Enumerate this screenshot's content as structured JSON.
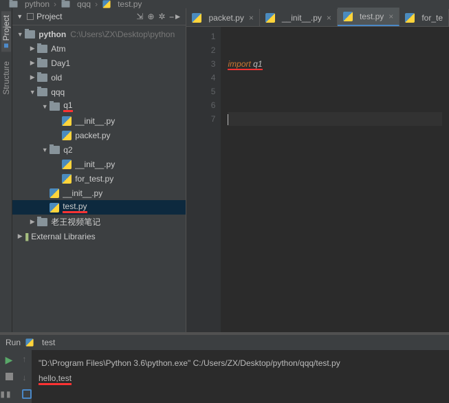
{
  "breadcrumbs": {
    "root": "python",
    "mid": "qqq",
    "file": "test.py"
  },
  "sideTabs": {
    "project": "Project",
    "structure": "Structure"
  },
  "projectPane": {
    "title": "Project"
  },
  "tree": {
    "root": {
      "name": "python",
      "path": "C:\\Users\\ZX\\Desktop\\python"
    },
    "atm": "Atm",
    "day1": "Day1",
    "old": "old",
    "qqq": "qqq",
    "q1": "q1",
    "q1_init": "__init__.py",
    "q1_packet": "packet.py",
    "q2": "q2",
    "q2_init": "__init__.py",
    "q2_for_test": "for_test.py",
    "qqq_init": "__init__.py",
    "qqq_test": "test.py",
    "laowang": "老王视频笔记",
    "extlib": "External Libraries"
  },
  "tabs": {
    "packet": "packet.py",
    "init": "__init__.py",
    "test": "test.py",
    "for_test": "for_te"
  },
  "editor": {
    "lines": [
      "1",
      "2",
      "3",
      "4",
      "5",
      "6",
      "7"
    ],
    "kw": "import",
    "ident": " q1"
  },
  "run": {
    "label": "Run",
    "config": "test",
    "cmd": "\"D:\\Program Files\\Python 3.6\\python.exe\" C:/Users/ZX/Desktop/python/qqq/test.py",
    "out": "hello,test"
  }
}
